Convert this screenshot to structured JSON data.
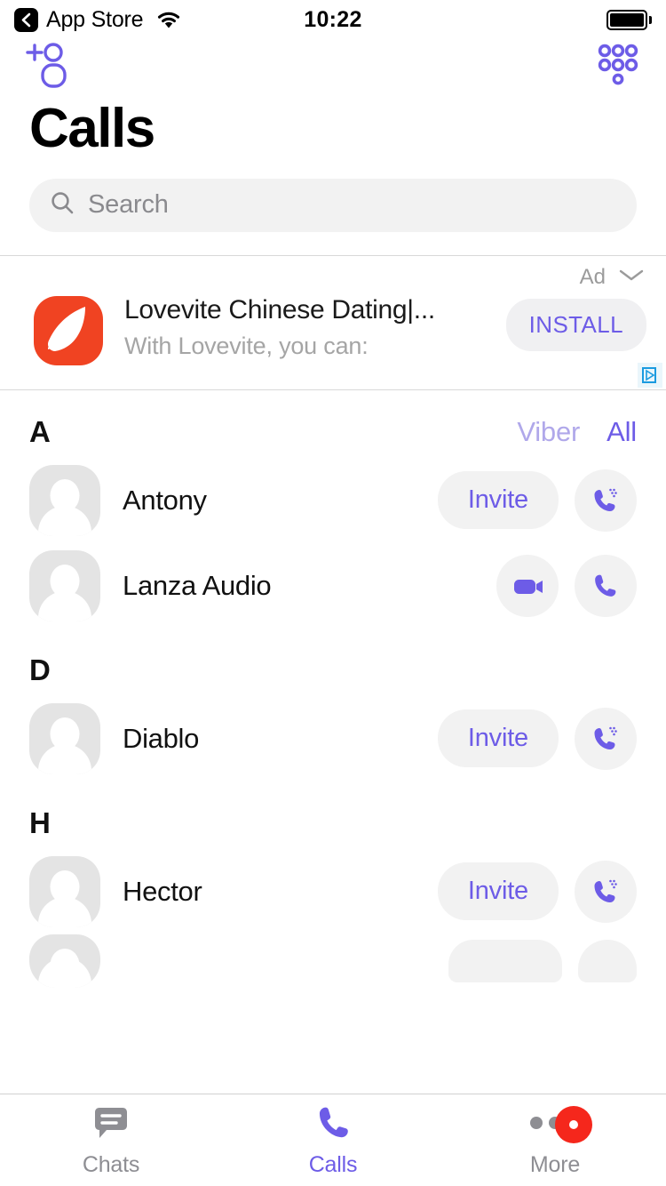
{
  "status_bar": {
    "back_label": "App Store",
    "back_icon": "chevron-left-icon",
    "wifi_icon": "wifi-icon",
    "time": "10:22",
    "battery_icon": "battery-full-icon"
  },
  "nav": {
    "add_contact_icon": "add-contact-icon",
    "keypad_icon": "dialpad-icon"
  },
  "header": {
    "title": "Calls"
  },
  "search": {
    "icon": "search-icon",
    "placeholder": "Search",
    "value": ""
  },
  "ad": {
    "label": "Ad",
    "chevron_icon": "chevron-down-icon",
    "app_icon": "lovevite-app-icon",
    "title": "Lovevite Chinese Dating|...",
    "subtitle": "With Lovevite, you can:",
    "cta": "INSTALL",
    "adchoices_icon": "adchoices-icon"
  },
  "filters": {
    "viber": "Viber",
    "all": "All",
    "active": "All",
    "colors": {
      "inactive": "#b0a8ea",
      "active": "#6d5ce7"
    }
  },
  "sections": [
    {
      "letter": "A",
      "contacts": [
        {
          "name": "Antony",
          "avatar_icon": "person-placeholder-icon",
          "invite_label": "Invite",
          "actions": [
            "invite",
            "viber-out-call"
          ],
          "call_icon": "phone-out-icon"
        },
        {
          "name": "Lanza Audio",
          "avatar_icon": "person-placeholder-icon",
          "invite_label": "",
          "actions": [
            "video-call",
            "audio-call"
          ],
          "video_icon": "video-camera-icon",
          "call_icon": "phone-icon"
        }
      ]
    },
    {
      "letter": "D",
      "contacts": [
        {
          "name": "Diablo",
          "avatar_icon": "person-placeholder-icon",
          "invite_label": "Invite",
          "actions": [
            "invite",
            "viber-out-call"
          ],
          "call_icon": "phone-out-icon"
        }
      ]
    },
    {
      "letter": "H",
      "contacts": [
        {
          "name": "Hector",
          "avatar_icon": "person-placeholder-icon",
          "invite_label": "Invite",
          "actions": [
            "invite",
            "viber-out-call"
          ],
          "call_icon": "phone-out-icon"
        }
      ]
    }
  ],
  "tab_bar": {
    "items": [
      {
        "label": "Chats",
        "icon": "chat-bubble-icon",
        "active": false
      },
      {
        "label": "Calls",
        "icon": "phone-icon",
        "active": true
      },
      {
        "label": "More",
        "icon": "more-dots-icon",
        "active": false,
        "badge": true
      }
    ]
  },
  "colors": {
    "brand_purple": "#6d5ce7",
    "brand_purple_light": "#b0a8ea",
    "badge_red": "#f5271c",
    "ad_orange": "#f04322",
    "field_grey": "#f2f2f2",
    "muted_text": "#8e8e93"
  }
}
